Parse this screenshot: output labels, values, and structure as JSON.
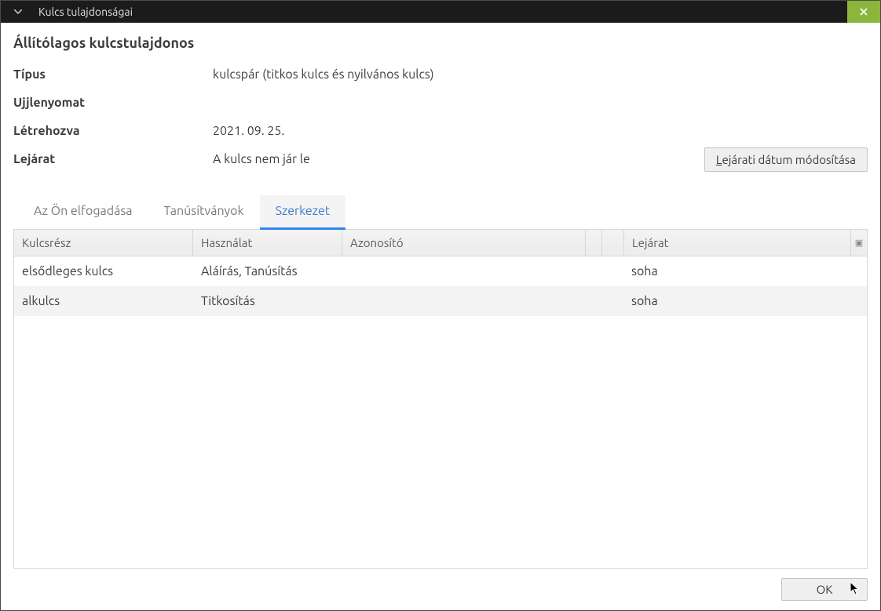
{
  "window": {
    "title": "Kulcs tulajdonságai"
  },
  "owner_heading": "Állítólagos kulcstulajdonos",
  "props": {
    "type_label": "Típus",
    "type_value": "kulcspár (titkos kulcs és nyilvános kulcs)",
    "fingerprint_label": "Ujjlenyomat",
    "fingerprint_value": "",
    "created_label": "Létrehozva",
    "created_value": "2021. 09. 25.",
    "expiry_label": "Lejárat",
    "expiry_value": "A kulcs nem jár le",
    "change_expiry_prefix": "L",
    "change_expiry_rest": "ejárati dátum módosítása"
  },
  "tabs": [
    {
      "label": "Az Ön elfogadása",
      "active": false
    },
    {
      "label": "Tanúsítványok",
      "active": false
    },
    {
      "label": "Szerkezet",
      "active": true
    }
  ],
  "table": {
    "headers": {
      "part": "Kulcsrész",
      "usage": "Használat",
      "id": "Azonosító",
      "expiry": "Lejárat"
    },
    "rows": [
      {
        "part": "elsődleges kulcs",
        "usage": "Aláírás, Tanúsítás",
        "id": "",
        "expiry": "soha"
      },
      {
        "part": "alkulcs",
        "usage": "Titkosítás",
        "id": "",
        "expiry": "soha"
      }
    ]
  },
  "buttons": {
    "ok": "OK"
  }
}
